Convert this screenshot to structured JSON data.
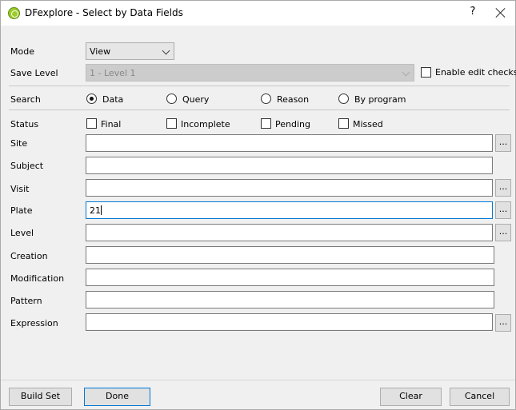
{
  "window": {
    "title": "DFexplore - Select by Data Fields",
    "help": "?",
    "app_icon": "dfexplore-icon"
  },
  "mode": {
    "label": "Mode",
    "value": "View"
  },
  "save_level": {
    "label": "Save Level",
    "value": "1 - Level 1",
    "enable_edit_checks": {
      "label": "Enable edit checks",
      "checked": false
    }
  },
  "search": {
    "label": "Search",
    "options": [
      {
        "label": "Data",
        "selected": true
      },
      {
        "label": "Query",
        "selected": false
      },
      {
        "label": "Reason",
        "selected": false
      },
      {
        "label": "By program",
        "selected": false
      }
    ]
  },
  "status": {
    "label": "Status",
    "options": [
      {
        "label": "Final",
        "checked": false
      },
      {
        "label": "Incomplete",
        "checked": false
      },
      {
        "label": "Pending",
        "checked": false
      },
      {
        "label": "Missed",
        "checked": false
      }
    ]
  },
  "fields": {
    "site": {
      "label": "Site",
      "value": ""
    },
    "subject": {
      "label": "Subject",
      "value": ""
    },
    "visit": {
      "label": "Visit",
      "value": ""
    },
    "plate": {
      "label": "Plate",
      "value": "21"
    },
    "level": {
      "label": "Level",
      "value": ""
    },
    "creation": {
      "label": "Creation",
      "value": ""
    },
    "modification": {
      "label": "Modification",
      "value": ""
    },
    "pattern": {
      "label": "Pattern",
      "value": ""
    },
    "expression": {
      "label": "Expression",
      "value": ""
    }
  },
  "ellipsis": "...",
  "buttons": {
    "build_set": "Build Set",
    "done": "Done",
    "clear": "Clear",
    "cancel": "Cancel"
  }
}
